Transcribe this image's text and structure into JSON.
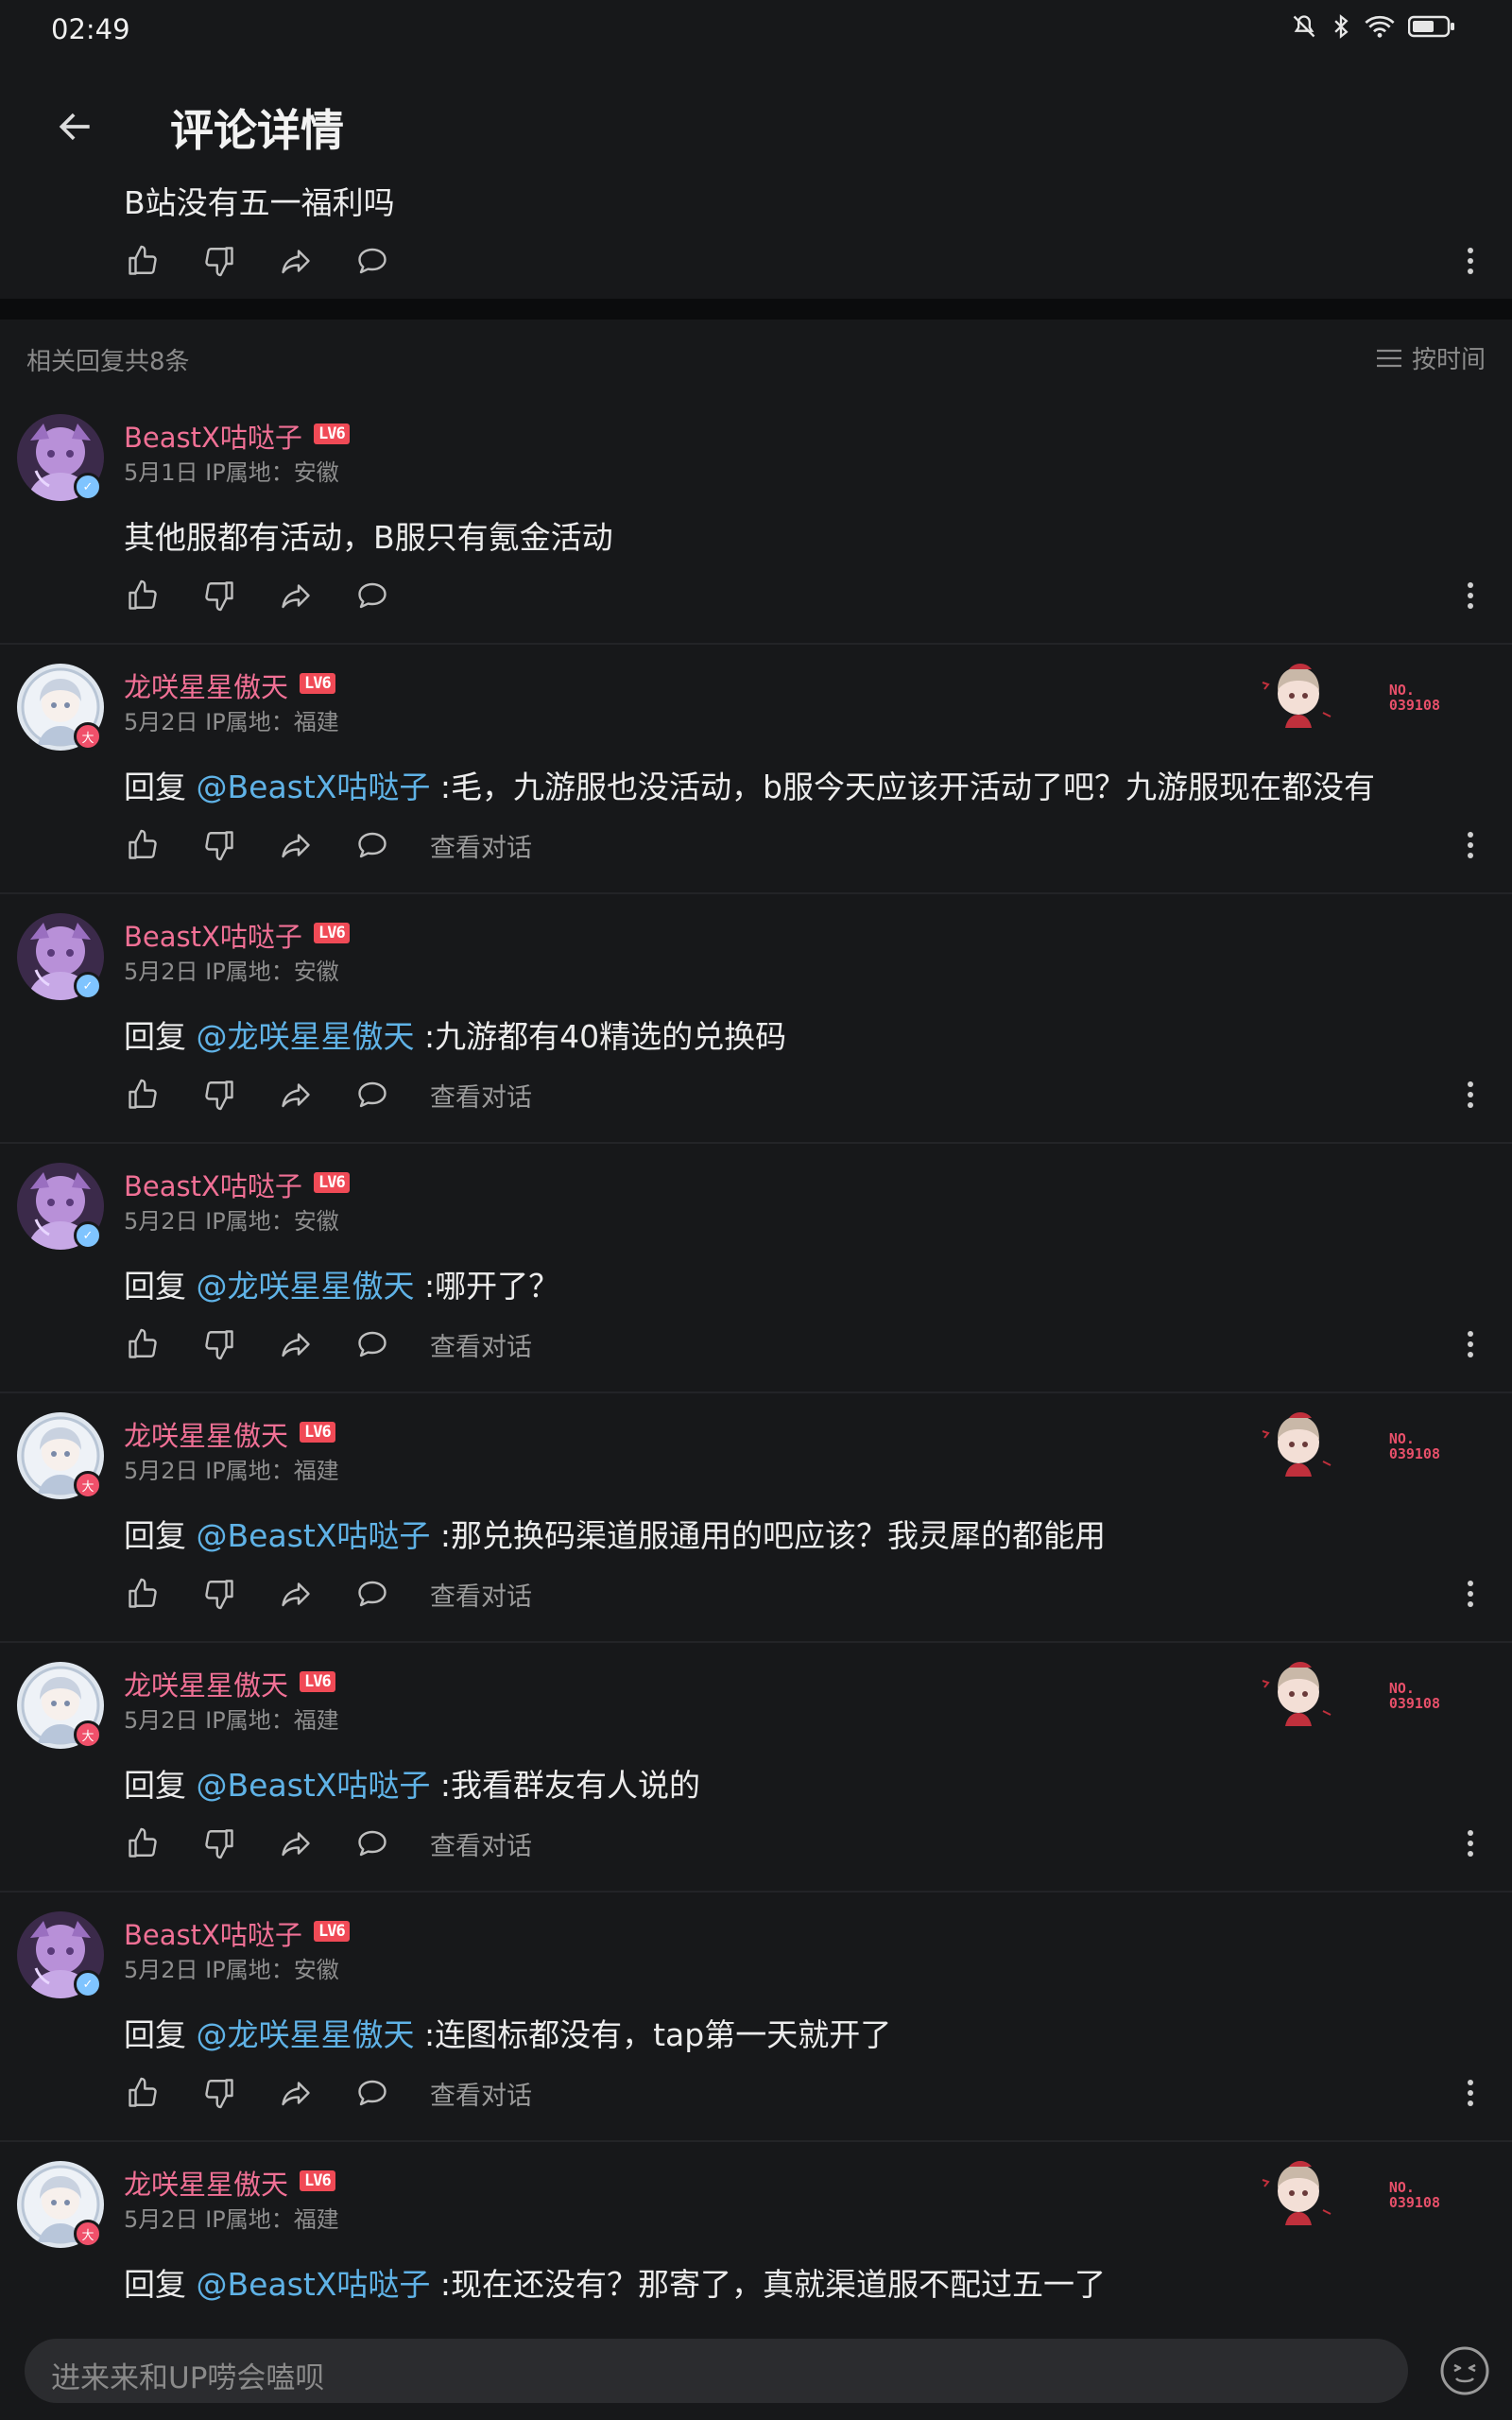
{
  "status": {
    "time": "02:49"
  },
  "header": {
    "title": "评论详情"
  },
  "root_comment": {
    "text": "B站没有五一福利吗"
  },
  "replies_header": {
    "count_text": "相关回复共8条",
    "sort_label": "按时间"
  },
  "view_conversation_label": "查看对话",
  "comments": [
    {
      "user": "BeastX咕哒子",
      "level": "LV6",
      "meta": "5月1日  IP属地：安徽",
      "prefix": "",
      "mention": "",
      "text": "其他服都有活动，B服只有氪金活动",
      "view_conv": "",
      "fan_no": ""
    },
    {
      "user": "龙咲星星傲天",
      "level": "LV6",
      "meta": "5月2日  IP属地：福建",
      "prefix": "回复 ",
      "mention": "@BeastX咕哒子",
      "text": " :毛，九游服也没活动，b服今天应该开活动了吧？九游服现在都没有",
      "view_conv": "查看对话",
      "fan_no": "NO.\n039108"
    },
    {
      "user": "BeastX咕哒子",
      "level": "LV6",
      "meta": "5月2日  IP属地：安徽",
      "prefix": "回复 ",
      "mention": "@龙咲星星傲天",
      "text": " :九游都有40精选的兑换码",
      "view_conv": "查看对话",
      "fan_no": ""
    },
    {
      "user": "BeastX咕哒子",
      "level": "LV6",
      "meta": "5月2日  IP属地：安徽",
      "prefix": "回复 ",
      "mention": "@龙咲星星傲天",
      "text": " :哪开了？",
      "view_conv": "查看对话",
      "fan_no": ""
    },
    {
      "user": "龙咲星星傲天",
      "level": "LV6",
      "meta": "5月2日  IP属地：福建",
      "prefix": "回复 ",
      "mention": "@BeastX咕哒子",
      "text": " :那兑换码渠道服通用的吧应该？我灵犀的都能用",
      "view_conv": "查看对话",
      "fan_no": "NO.\n039108"
    },
    {
      "user": "龙咲星星傲天",
      "level": "LV6",
      "meta": "5月2日  IP属地：福建",
      "prefix": "回复 ",
      "mention": "@BeastX咕哒子",
      "text": " :我看群友有人说的",
      "view_conv": "查看对话",
      "fan_no": "NO.\n039108"
    },
    {
      "user": "BeastX咕哒子",
      "level": "LV6",
      "meta": "5月2日  IP属地：安徽",
      "prefix": "回复 ",
      "mention": "@龙咲星星傲天",
      "text": " :连图标都没有，tap第一天就开了",
      "view_conv": "查看对话",
      "fan_no": ""
    },
    {
      "user": "龙咲星星傲天",
      "level": "LV6",
      "meta": "5月2日  IP属地：福建",
      "prefix": "回复 ",
      "mention": "@BeastX咕哒子",
      "text": " :现在还没有？那寄了，真就渠道服不配过五一了",
      "view_conv": "",
      "fan_no": "NO.\n039108"
    }
  ],
  "input": {
    "placeholder": "进来来和UP唠会嗑呗"
  },
  "colors": {
    "username": "#f07095",
    "mention": "#5fb2e6",
    "level_badge": "#f04a56",
    "background": "#17181a"
  }
}
